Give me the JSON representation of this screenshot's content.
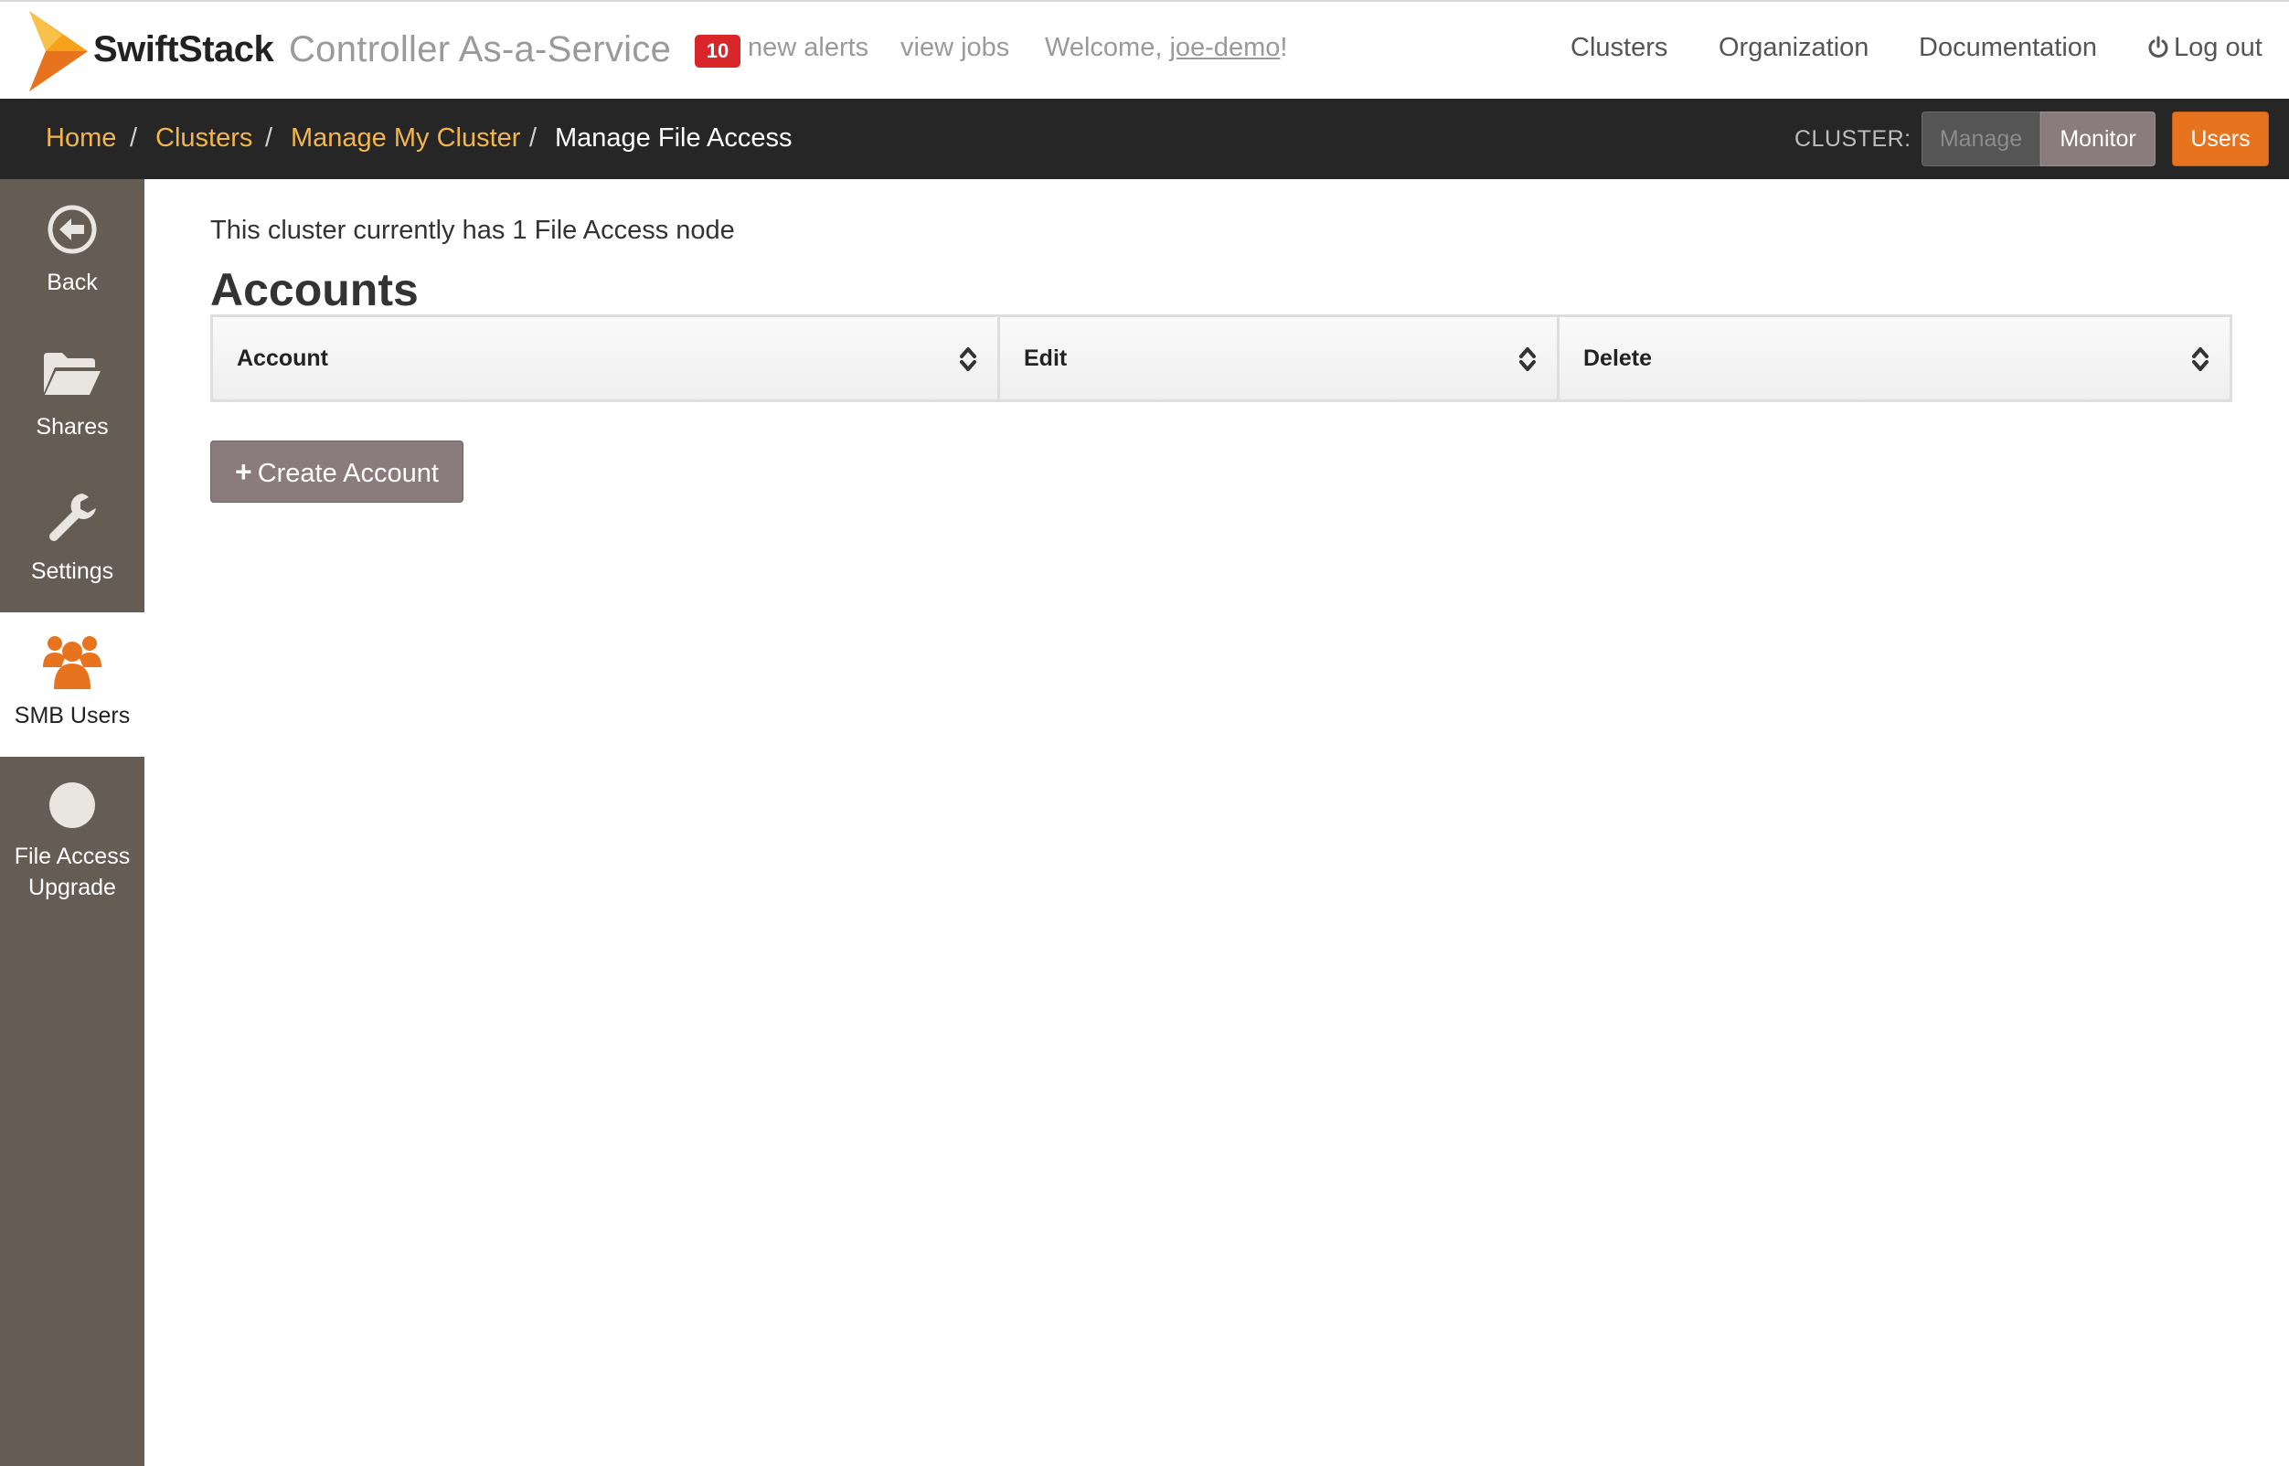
{
  "header": {
    "brand": "SwiftStack",
    "product": "Controller As-a-Service",
    "alerts_count": "10",
    "alerts_label": "new alerts",
    "jobs_label": "view jobs",
    "welcome_prefix": "Welcome, ",
    "welcome_user": "joe-demo",
    "welcome_suffix": "!",
    "nav": {
      "clusters": "Clusters",
      "organization": "Organization",
      "documentation": "Documentation",
      "logout": "Log out"
    },
    "colors": {
      "brand_orange": "#f7a21b",
      "alert_red": "#d9262b"
    }
  },
  "breadcrumb": {
    "items": [
      "Home",
      "Clusters",
      "Manage My Cluster",
      "Manage File Access"
    ],
    "separator": "/"
  },
  "cluster_switch": {
    "label": "CLUSTER:",
    "manage": "Manage",
    "monitor": "Monitor",
    "users": "Users"
  },
  "sidebar": {
    "items": [
      {
        "label": "Back",
        "icon": "back-circle-arrow-icon"
      },
      {
        "label": "Shares",
        "icon": "folder-open-icon"
      },
      {
        "label": "Settings",
        "icon": "wrench-icon"
      },
      {
        "label": "SMB Users",
        "icon": "users-group-icon",
        "active": true
      },
      {
        "label": "File Access Upgrade",
        "icon": "circle-icon"
      }
    ],
    "file_access_upgrade_line1": "File Access",
    "file_access_upgrade_line2": "Upgrade"
  },
  "main": {
    "info": "This cluster currently has 1 File Access node",
    "title": "Accounts",
    "table": {
      "columns": [
        "Account",
        "Edit",
        "Delete"
      ],
      "rows": []
    },
    "create_button": "Create Account"
  }
}
